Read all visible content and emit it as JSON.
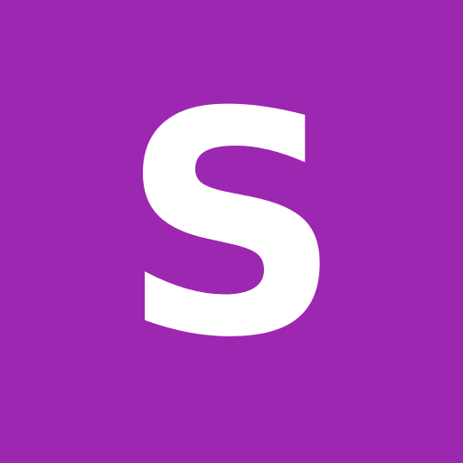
{
  "avatar": {
    "letter": "S",
    "background_color": "#9c27b0",
    "text_color": "#ffffff"
  }
}
